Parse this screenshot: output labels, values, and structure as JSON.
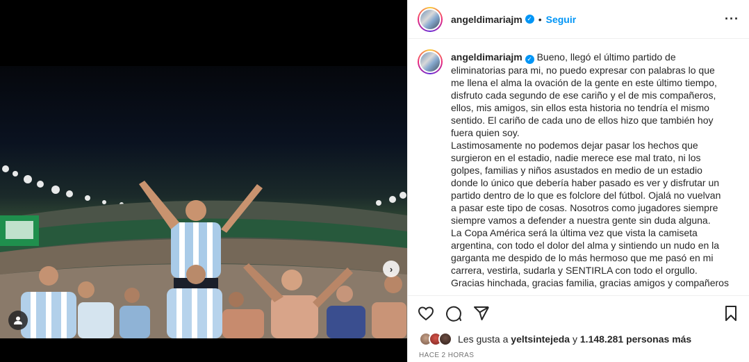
{
  "post": {
    "username": "angeldimariajm",
    "follow_label": "Seguir",
    "more_icon": "more-options-icon",
    "caption": "Bueno, llegó el último partido de eliminatorias para mi, no puedo expresar con palabras lo que me llena el alma la ovación de la gente en este último tiempo, disfruto cada segundo de ese cariño y el de mis compañeros, ellos, mis amigos, sin ellos esta historia no tendría el mismo sentido. El cariño de cada uno de ellos hizo que también hoy fuera quien soy.\nLastimosamente no podemos dejar pasar los hechos que surgieron en el estadio, nadie merece ese mal trato, ni los golpes, familias y niños asustados en medio de un estadio donde lo único que debería haber pasado es ver y disfrutar un partido dentro de lo que es folclore del fútbol. Ojalá no vuelvan a pasar este tipo de cosas. Nosotros como jugadores siempre siempre vamos a defender a nuestra gente sin duda alguna.\nLa Copa América será la última vez que vista la camiseta argentina, con todo el dolor del alma y sintiendo un nudo en la garganta me despido de lo más hermoso que me pasó en mi carrera, vestirla, sudarla y SENTIRLA con todo el orgullo.\nGracias hinchada, gracias familia, gracias amigos y compañeros"
  },
  "likes": {
    "prefix": "Les gusta a",
    "user": "yeltsintejeda",
    "conjunction": "y",
    "count": "1.148.281 personas más"
  },
  "timestamp": "HACE 2 HORAS",
  "colors": {
    "accent": "#0095f6",
    "verified": "#0095f6",
    "text": "#262626",
    "muted": "#737373"
  },
  "icons": [
    "heart-icon",
    "comment-icon",
    "share-icon",
    "bookmark-icon",
    "verified-badge-icon",
    "chevron-right-icon",
    "tagged-user-icon"
  ]
}
